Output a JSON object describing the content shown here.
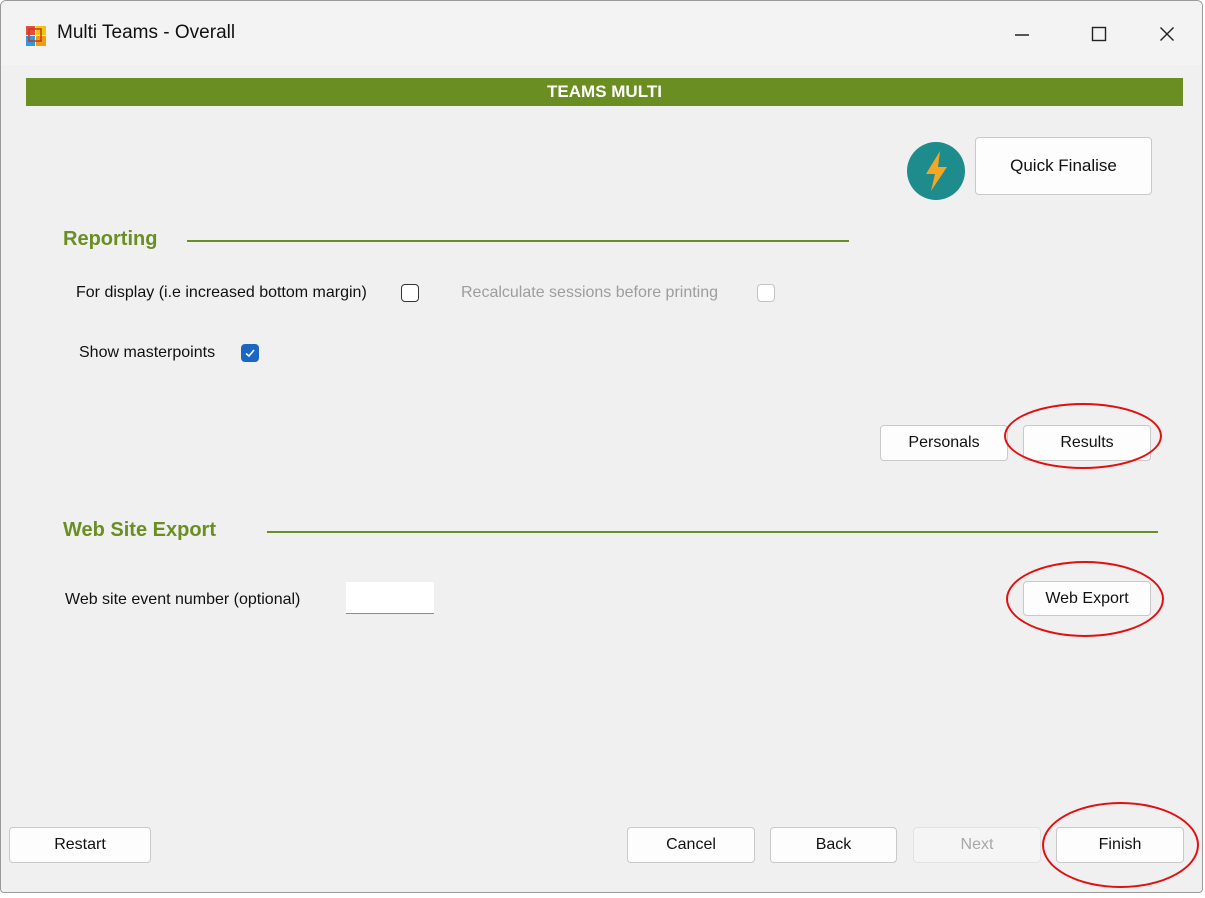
{
  "window": {
    "title": "Multi Teams - Overall",
    "controls": {
      "minimize": "—",
      "maximize": "☐",
      "close": "✕"
    }
  },
  "banner": {
    "text": "TEAMS MULTI",
    "color": "#6b8e23"
  },
  "quick_finalise": {
    "label": "Quick Finalise",
    "icon": "lightning-bolt-icon"
  },
  "reporting": {
    "title": "Reporting",
    "for_display_label": "For display (i.e increased bottom margin)",
    "for_display_checked": false,
    "recalculate_label": "Recalculate sessions before printing",
    "recalculate_checked": false,
    "recalculate_enabled": false,
    "show_masterpoints_label": "Show masterpoints",
    "show_masterpoints_checked": true,
    "personals_label": "Personals",
    "results_label": "Results"
  },
  "web_export": {
    "title": "Web Site Export",
    "event_number_label": "Web site event number (optional)",
    "event_number_value": "",
    "web_export_label": "Web Export"
  },
  "footer": {
    "restart_label": "Restart",
    "cancel_label": "Cancel",
    "back_label": "Back",
    "next_label": "Next",
    "next_enabled": false,
    "finish_label": "Finish"
  },
  "colors": {
    "accent": "#6b8e23",
    "annotation": "#e01010",
    "checkbox_checked": "#1a66c2"
  }
}
